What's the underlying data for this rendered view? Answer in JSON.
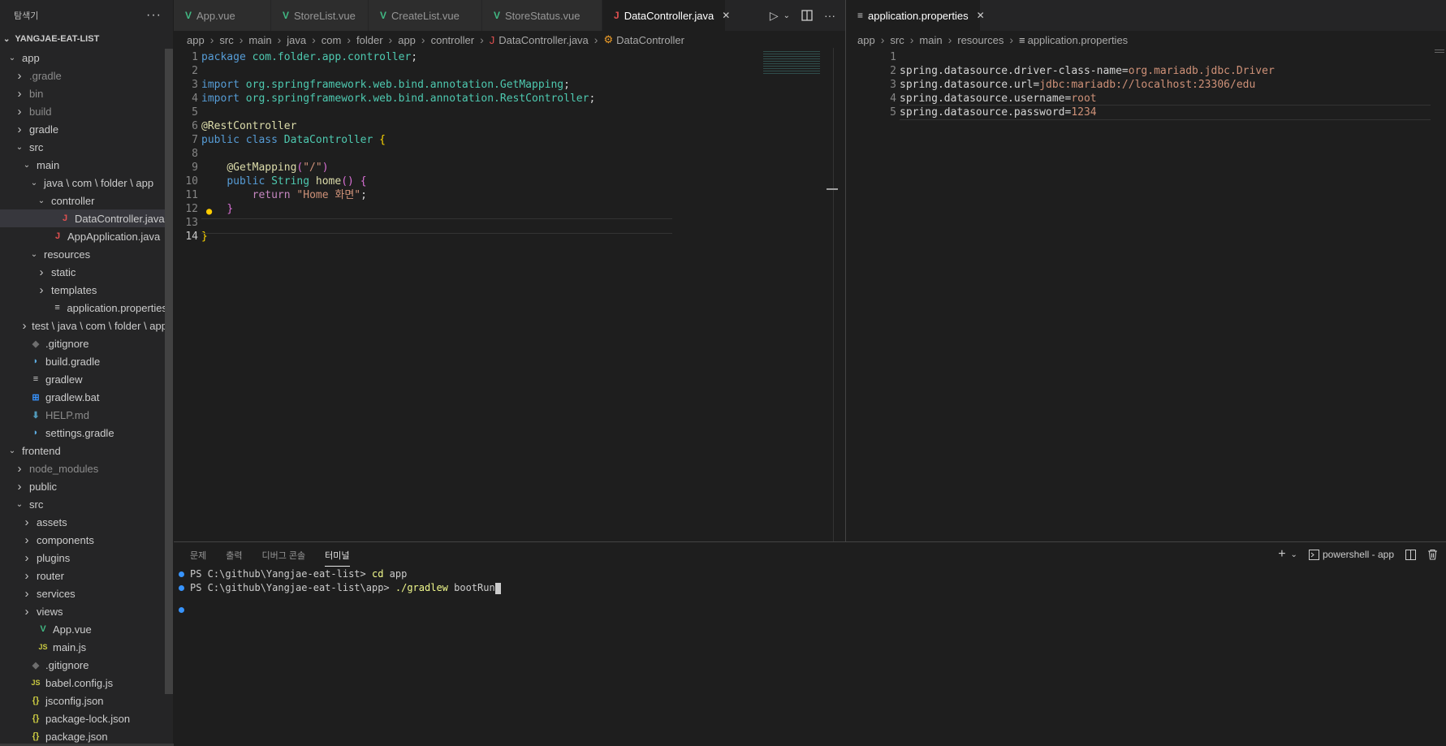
{
  "sidebar": {
    "title": "탐색기",
    "more_icon": "ellipsis-icon",
    "section": "YANGJAE-EAT-LIST",
    "items": [
      {
        "label": "app",
        "depth": 0,
        "chevron": "down",
        "icon": ""
      },
      {
        "label": ".gradle",
        "depth": 1,
        "chevron": "right",
        "icon": "",
        "dim": true
      },
      {
        "label": "bin",
        "depth": 1,
        "chevron": "right",
        "icon": "",
        "dim": true
      },
      {
        "label": "build",
        "depth": 1,
        "chevron": "right",
        "icon": "",
        "dim": true
      },
      {
        "label": "gradle",
        "depth": 1,
        "chevron": "right",
        "icon": ""
      },
      {
        "label": "src",
        "depth": 1,
        "chevron": "down",
        "icon": ""
      },
      {
        "label": "main",
        "depth": 2,
        "chevron": "down",
        "icon": ""
      },
      {
        "label": "java \\ com \\ folder \\ app",
        "depth": 3,
        "chevron": "down",
        "icon": ""
      },
      {
        "label": "controller",
        "depth": 4,
        "chevron": "down",
        "icon": ""
      },
      {
        "label": "DataController.java",
        "depth": 5,
        "chevron": "",
        "icon": "java",
        "selected": true
      },
      {
        "label": "AppApplication.java",
        "depth": 4,
        "chevron": "",
        "icon": "java"
      },
      {
        "label": "resources",
        "depth": 3,
        "chevron": "down",
        "icon": ""
      },
      {
        "label": "static",
        "depth": 4,
        "chevron": "right",
        "icon": ""
      },
      {
        "label": "templates",
        "depth": 4,
        "chevron": "right",
        "icon": ""
      },
      {
        "label": "application.properties",
        "depth": 4,
        "chevron": "",
        "icon": "props"
      },
      {
        "label": "test \\ java \\ com \\ folder \\ app",
        "depth": 2,
        "chevron": "right",
        "icon": ""
      },
      {
        "label": ".gitignore",
        "depth": 1,
        "chevron": "",
        "icon": "git"
      },
      {
        "label": "build.gradle",
        "depth": 1,
        "chevron": "",
        "icon": "gradle"
      },
      {
        "label": "gradlew",
        "depth": 1,
        "chevron": "",
        "icon": "props"
      },
      {
        "label": "gradlew.bat",
        "depth": 1,
        "chevron": "",
        "icon": "windows"
      },
      {
        "label": "HELP.md",
        "depth": 1,
        "chevron": "",
        "icon": "md",
        "dim": true
      },
      {
        "label": "settings.gradle",
        "depth": 1,
        "chevron": "",
        "icon": "gradle"
      },
      {
        "label": "frontend",
        "depth": 0,
        "chevron": "down",
        "icon": ""
      },
      {
        "label": "node_modules",
        "depth": 1,
        "chevron": "right",
        "icon": "",
        "dim": true
      },
      {
        "label": "public",
        "depth": 1,
        "chevron": "right",
        "icon": ""
      },
      {
        "label": "src",
        "depth": 1,
        "chevron": "down",
        "icon": ""
      },
      {
        "label": "assets",
        "depth": 2,
        "chevron": "right",
        "icon": ""
      },
      {
        "label": "components",
        "depth": 2,
        "chevron": "right",
        "icon": ""
      },
      {
        "label": "plugins",
        "depth": 2,
        "chevron": "right",
        "icon": ""
      },
      {
        "label": "router",
        "depth": 2,
        "chevron": "right",
        "icon": ""
      },
      {
        "label": "services",
        "depth": 2,
        "chevron": "right",
        "icon": ""
      },
      {
        "label": "views",
        "depth": 2,
        "chevron": "right",
        "icon": ""
      },
      {
        "label": "App.vue",
        "depth": 2,
        "chevron": "",
        "icon": "vue"
      },
      {
        "label": "main.js",
        "depth": 2,
        "chevron": "",
        "icon": "js"
      },
      {
        "label": ".gitignore",
        "depth": 1,
        "chevron": "",
        "icon": "git"
      },
      {
        "label": "babel.config.js",
        "depth": 1,
        "chevron": "",
        "icon": "js"
      },
      {
        "label": "jsconfig.json",
        "depth": 1,
        "chevron": "",
        "icon": "json"
      },
      {
        "label": "package-lock.json",
        "depth": 1,
        "chevron": "",
        "icon": "json"
      },
      {
        "label": "package.json",
        "depth": 1,
        "chevron": "",
        "icon": "json"
      }
    ]
  },
  "tabs_left": [
    {
      "label": "App.vue",
      "icon": "vue",
      "active": false
    },
    {
      "label": "StoreList.vue",
      "icon": "vue",
      "active": false
    },
    {
      "label": "CreateList.vue",
      "icon": "vue",
      "active": false
    },
    {
      "label": "StoreStatus.vue",
      "icon": "vue",
      "active": false
    },
    {
      "label": "DataController.java",
      "icon": "java",
      "active": true
    }
  ],
  "tabs_right": [
    {
      "label": "application.properties",
      "icon": "props",
      "active": true
    }
  ],
  "breadcrumb_left": [
    "app",
    "src",
    "main",
    "java",
    "com",
    "folder",
    "app",
    "controller",
    "DataController.java",
    "DataController"
  ],
  "breadcrumb_right": [
    "app",
    "src",
    "main",
    "resources",
    "application.properties"
  ],
  "editor_left": {
    "current_line": 14,
    "lines": [
      [
        [
          "kw",
          "package "
        ],
        [
          "pkg",
          "com.folder.app.controller"
        ],
        [
          "plain",
          ";"
        ]
      ],
      [],
      [
        [
          "kw",
          "import "
        ],
        [
          "pkg",
          "org.springframework.web.bind.annotation.GetMapping"
        ],
        [
          "plain",
          ";"
        ]
      ],
      [
        [
          "kw",
          "import "
        ],
        [
          "pkg",
          "org.springframework.web.bind.annotation.RestController"
        ],
        [
          "plain",
          ";"
        ]
      ],
      [],
      [
        [
          "ann",
          "@RestController"
        ]
      ],
      [
        [
          "kw",
          "public class "
        ],
        [
          "typ",
          "DataController "
        ],
        [
          "br",
          "{"
        ]
      ],
      [],
      [
        [
          "plain",
          "    "
        ],
        [
          "ann",
          "@GetMapping"
        ],
        [
          "br2",
          "("
        ],
        [
          "str",
          "\"/\""
        ],
        [
          "br2",
          ")"
        ]
      ],
      [
        [
          "plain",
          "    "
        ],
        [
          "kw",
          "public "
        ],
        [
          "typ",
          "String "
        ],
        [
          "fn",
          "home"
        ],
        [
          "br2",
          "() {"
        ]
      ],
      [
        [
          "plain",
          "        "
        ],
        [
          "kw2",
          "return "
        ],
        [
          "str",
          "\"Home 화면\""
        ],
        [
          "plain",
          ";"
        ]
      ],
      [
        [
          "plain",
          "    "
        ],
        [
          "br2",
          "}"
        ]
      ],
      [],
      [
        [
          "br",
          "}"
        ]
      ]
    ]
  },
  "editor_right": {
    "lines": [
      [],
      [
        [
          "propk",
          "spring.datasource.driver-class-name="
        ],
        [
          "propv",
          "org.mariadb.jdbc.Driver"
        ]
      ],
      [
        [
          "propk",
          "spring.datasource.url="
        ],
        [
          "propv",
          "jdbc:mariadb://localhost:23306/edu"
        ]
      ],
      [
        [
          "propk",
          "spring.datasource.username="
        ],
        [
          "propv",
          "root"
        ]
      ],
      [
        [
          "propk",
          "spring.datasource.password="
        ],
        [
          "propv",
          "1234"
        ]
      ]
    ]
  },
  "panel": {
    "tabs": [
      "문제",
      "출력",
      "디버그 콘솔",
      "터미널"
    ],
    "active_tab": "터미널",
    "shell_label": "powershell - app",
    "terminal": [
      {
        "prompt": "PS C:\\github\\Yangjae-eat-list> ",
        "command": "cd",
        "args": " app"
      },
      {
        "prompt": "PS C:\\github\\Yangjae-eat-list\\app> ",
        "command": "./gradlew",
        "args": " bootRun"
      }
    ]
  }
}
